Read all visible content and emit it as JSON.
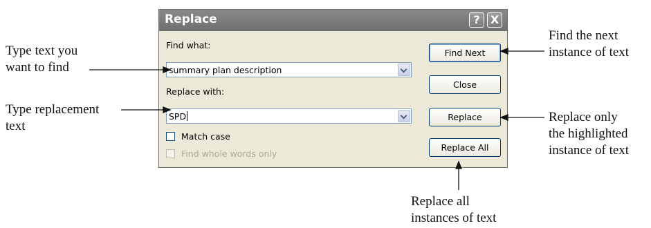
{
  "dialog": {
    "title": "Replace",
    "help_glyph": "?",
    "close_glyph": "X",
    "find_label": "Find what:",
    "find_value": "summary plan description",
    "replace_label": "Replace with:",
    "replace_value": "SPD",
    "match_case_label": "Match case",
    "whole_words_label": "Find whole words only",
    "buttons": {
      "find_next": "Find Next",
      "close": "Close",
      "replace": "Replace",
      "replace_all": "Replace All"
    }
  },
  "callouts": {
    "type_find": [
      "Type text you",
      "want to find"
    ],
    "type_replace": [
      "Type replacement",
      "text"
    ],
    "find_next": [
      "Find the next",
      "instance of text"
    ],
    "replace_only": [
      "Replace only",
      "the highlighted",
      "instance of text"
    ],
    "replace_all": [
      "Replace all",
      "instances of text"
    ]
  },
  "icons": {
    "help": "help-icon",
    "close": "close-icon",
    "dropdown": "chevron-down-icon"
  }
}
